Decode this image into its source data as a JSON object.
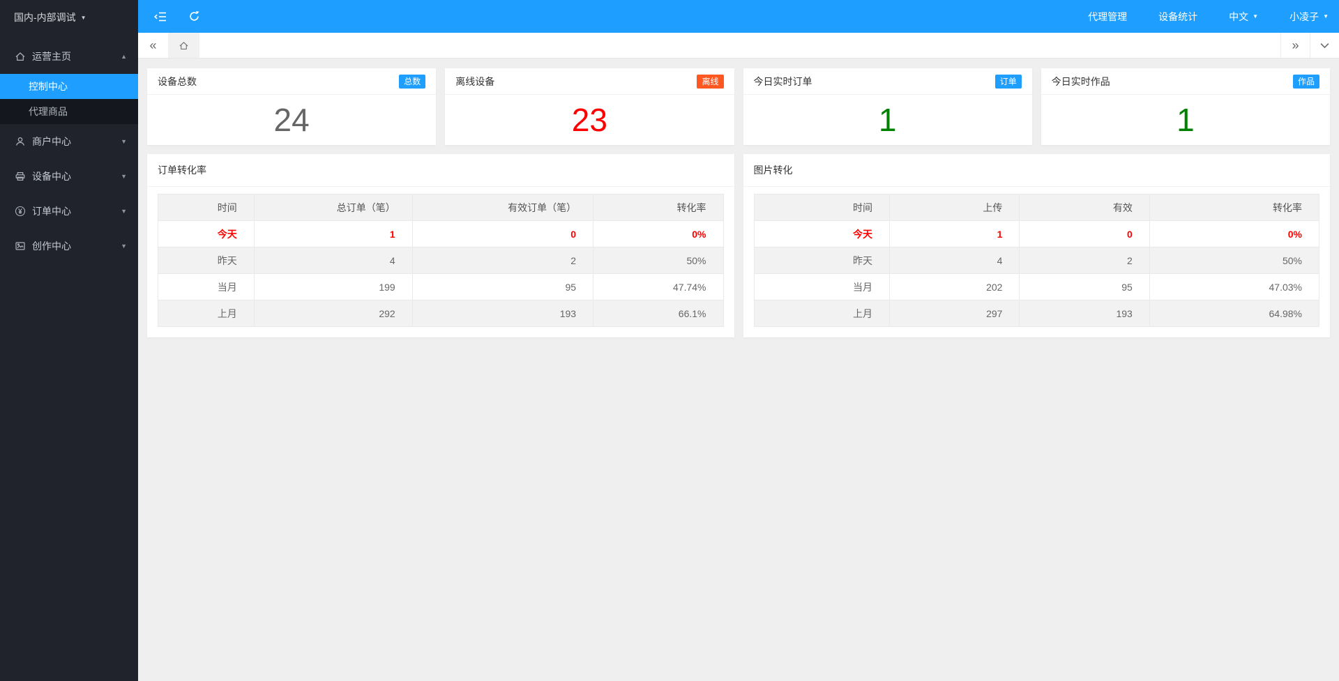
{
  "colors": {
    "accent": "#1E9FFF",
    "badge_danger": "#FF5722",
    "value_red": "#ff0000",
    "value_green": "#008000",
    "value_gray": "#666666",
    "sidebar_bg": "#20232b",
    "submenu_bg": "#15171e",
    "content_bg": "#efefef"
  },
  "sidebar": {
    "environment_label": "国内-内部调试",
    "menu": [
      {
        "label": "运营主页",
        "icon": "home-icon",
        "state": "expanded",
        "arrow": "▲",
        "children": [
          {
            "label": "控制中心",
            "active": true
          },
          {
            "label": "代理商品",
            "active": false
          }
        ]
      },
      {
        "label": "商户中心",
        "icon": "merchant-icon",
        "state": "collapsed",
        "arrow": "▼"
      },
      {
        "label": "设备中心",
        "icon": "device-icon",
        "state": "collapsed",
        "arrow": "▼"
      },
      {
        "label": "订单中心",
        "icon": "order-yen-icon",
        "state": "collapsed",
        "arrow": "▼"
      },
      {
        "label": "创作中心",
        "icon": "creation-image-icon",
        "state": "collapsed",
        "arrow": "▼"
      }
    ]
  },
  "topbar": {
    "icons": [
      "collapse-sidebar-icon",
      "refresh-icon"
    ],
    "nav": [
      {
        "label": "代理管理",
        "dropdown": false
      },
      {
        "label": "设备统计",
        "dropdown": false
      },
      {
        "label": "中文",
        "dropdown": true
      },
      {
        "label": "小凌子",
        "dropdown": true
      }
    ],
    "dropdown_caret": "▼"
  },
  "tabbar": {
    "icons": [
      "scroll-left-icon",
      "home-icon",
      "scroll-right-icon",
      "chevron-down-icon"
    ],
    "scroll_left_glyph": "«",
    "scroll_right_glyph": "»"
  },
  "stat_cards": [
    {
      "title": "设备总数",
      "badge": "总数",
      "badge_color": "#1E9FFF",
      "value": "24",
      "value_color": "#666666"
    },
    {
      "title": "离线设备",
      "badge": "离线",
      "badge_color": "#FF5722",
      "value": "23",
      "value_color": "#ff0000"
    },
    {
      "title": "今日实时订单",
      "badge": "订单",
      "badge_color": "#1E9FFF",
      "value": "1",
      "value_color": "#008000"
    },
    {
      "title": "今日实时作品",
      "badge": "作品",
      "badge_color": "#1E9FFF",
      "value": "1",
      "value_color": "#008000"
    }
  ],
  "tables": [
    {
      "title": "订单转化率",
      "headers": [
        "时间",
        "总订单（笔）",
        "有效订单（笔）",
        "转化率"
      ],
      "rows": [
        [
          "今天",
          "1",
          "0",
          "0%"
        ],
        [
          "昨天",
          "4",
          "2",
          "50%"
        ],
        [
          "当月",
          "199",
          "95",
          "47.74%"
        ],
        [
          "上月",
          "292",
          "193",
          "66.1%"
        ]
      ]
    },
    {
      "title": "图片转化",
      "headers": [
        "时间",
        "上传",
        "有效",
        "转化率"
      ],
      "rows": [
        [
          "今天",
          "1",
          "0",
          "0%"
        ],
        [
          "昨天",
          "4",
          "2",
          "50%"
        ],
        [
          "当月",
          "202",
          "95",
          "47.03%"
        ],
        [
          "上月",
          "297",
          "193",
          "64.98%"
        ]
      ]
    }
  ]
}
